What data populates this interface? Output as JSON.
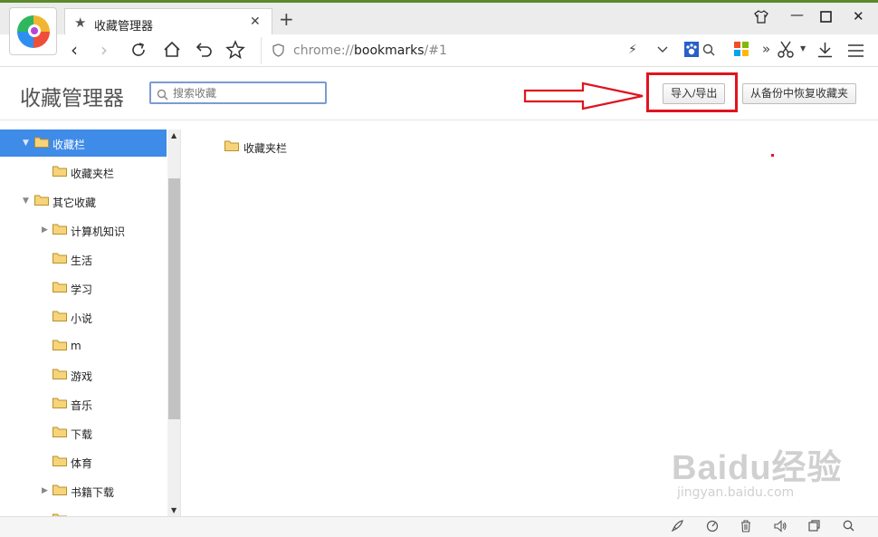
{
  "tab": {
    "title": "收藏管理器"
  },
  "window_icons": [
    "shirt-icon",
    "minimize-icon",
    "maximize-icon",
    "close-icon"
  ],
  "address_bar": {
    "scheme": "chrome://",
    "host": "bookmarks",
    "path": "/#1"
  },
  "header": {
    "title": "收藏管理器",
    "search_placeholder": "搜索收藏",
    "import_export_label": "导入/导出",
    "restore_label": "从备份中恢复收藏夹"
  },
  "tree": {
    "items": [
      {
        "label": "收藏栏",
        "selected": true,
        "expanded": true
      },
      {
        "label": "收藏夹栏"
      },
      {
        "label": "其它收藏",
        "expanded": true
      },
      {
        "label": "计算机知识",
        "collapsed_children": true
      },
      {
        "label": "生活"
      },
      {
        "label": "学习"
      },
      {
        "label": "小说"
      },
      {
        "label": "m"
      },
      {
        "label": "游戏"
      },
      {
        "label": "音乐"
      },
      {
        "label": "下载"
      },
      {
        "label": "体育"
      },
      {
        "label": "书籍下载",
        "collapsed_children": true
      }
    ]
  },
  "content": {
    "items": [
      {
        "label": "收藏夹栏"
      }
    ]
  },
  "watermark": {
    "brand": "Baidu经验",
    "url": "jingyan.baidu.com"
  },
  "colors": {
    "selection": "#3f8be8",
    "highlight_red": "#e0141e",
    "folder_fill": "#f7d37a"
  },
  "status_icons": [
    "rocket-icon",
    "speed-icon",
    "trash-icon",
    "volume-icon",
    "window-icon",
    "zoom-icon"
  ]
}
